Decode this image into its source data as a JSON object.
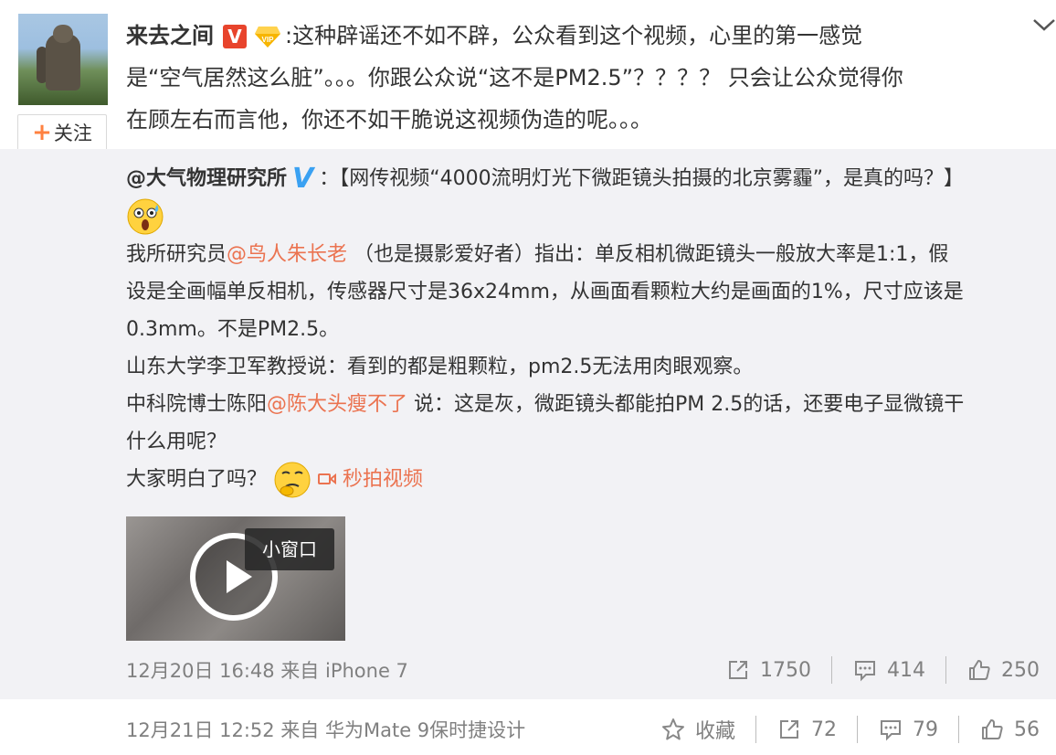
{
  "post": {
    "author": "来去之间",
    "verified_badge": "V",
    "vip_badge": "VIP",
    "follow_label": "关注",
    "follow_plus": "+",
    "text_line1": "这种辟谣还不如不辟，公众看到这个视频，心里的第一感觉",
    "text_line2": "是“空气居然这么脏”。。。你跟公众说“这不是PM2.5”？？？？ 只会让公众觉得你",
    "text_line3": "在顾左右而言他，你还不如干脆说这视频伪造的呢。。。",
    "colon": ":"
  },
  "repost": {
    "source_name": "@大气物理研究所",
    "source_colon": "：",
    "headline": "【网传视频“4000流明灯光下微距镜头拍摄的北京雾霾”，是真的吗？】",
    "p1_before": "我所研究员",
    "p1_mention": "@鸟人朱长老",
    "p1_after_line1": " （也是摄影爱好者）指出：单反相机微距镜头一般放大率是1:1，假",
    "p1_line2": "设是全画幅单反相机，传感器尺寸是36x24mm，从画面看颗粒大约是画面的1%，尺寸应该是",
    "p1_line3": "0.3mm。不是PM2.5。",
    "p2": "山东大学李卫军教授说：看到的都是粗颗粒，pm2.5无法用肉眼观察。",
    "p3_before": "中科院博士陈阳",
    "p3_mention": "@陈大头瘦不了",
    "p3_after_line1": " 说：这是灰，微距镜头都能拍PM 2.5的话，还要电子显微镜干",
    "p3_line2": "什么用呢？",
    "p4": "大家明白了吗？",
    "video_link_label": "秒拍视频",
    "mini_window_label": "小窗口",
    "timestamp": "12月20日 16:48 来自 iPhone 7",
    "reposts": "1750",
    "comments": "414",
    "likes": "250"
  },
  "footer": {
    "timestamp": "12月21日 12:52 来自 华为Mate 9保时捷设计",
    "favorite_label": "收藏",
    "reposts": "72",
    "comments": "79",
    "likes": "56"
  },
  "colors": {
    "link": "#eb7350",
    "accent_orange": "#ff8140",
    "verified_blue": "#3aa1f2",
    "verified_red": "#e8442c",
    "repost_bg": "#f2f2f5"
  }
}
